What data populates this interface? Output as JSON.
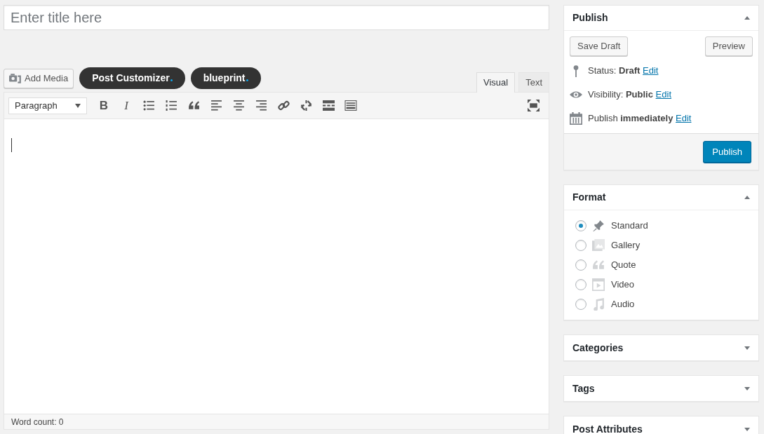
{
  "title_field": {
    "placeholder": "Enter title here"
  },
  "media_buttons": [
    {
      "kind": "media",
      "label": "Add Media"
    },
    {
      "kind": "plugin",
      "label": "Post Customizer"
    },
    {
      "kind": "plugin",
      "label": "blueprint"
    }
  ],
  "editor_tabs": [
    {
      "label": "Visual",
      "selected": true
    },
    {
      "label": "Text",
      "selected": false
    }
  ],
  "toolbar": {
    "format_select": "Paragraph",
    "tools": [
      {
        "kind": "bold",
        "glyph": "B"
      },
      {
        "kind": "italic",
        "glyph": "I"
      },
      {
        "kind": "bullet-list"
      },
      {
        "kind": "numbered-list"
      },
      {
        "kind": "quote"
      },
      {
        "kind": "align-left"
      },
      {
        "kind": "align-center"
      },
      {
        "kind": "align-right"
      },
      {
        "kind": "link"
      },
      {
        "kind": "unlink"
      },
      {
        "kind": "more"
      },
      {
        "kind": "keyboard"
      }
    ]
  },
  "word_count": "Word count: 0",
  "publish_box": {
    "title": "Publish",
    "expanded": true,
    "save_draft": "Save Draft",
    "preview": "Preview",
    "rows": [
      {
        "kind": "status",
        "label": "Status:",
        "value": "Draft",
        "link": "Edit"
      },
      {
        "kind": "visibility",
        "label": "Visibility:",
        "value": "Public",
        "link": "Edit"
      },
      {
        "kind": "schedule",
        "label": "Publish",
        "value": "immediately",
        "link": "Edit"
      }
    ],
    "publish_button": "Publish"
  },
  "format_box": {
    "title": "Format",
    "expanded": true,
    "options": [
      {
        "kind": "standard",
        "label": "Standard",
        "selected": true
      },
      {
        "kind": "gallery",
        "label": "Gallery",
        "selected": false
      },
      {
        "kind": "quote",
        "label": "Quote",
        "selected": false
      },
      {
        "kind": "video",
        "label": "Video",
        "selected": false
      },
      {
        "kind": "audio",
        "label": "Audio",
        "selected": false
      }
    ]
  },
  "other_boxes": [
    {
      "title": "Categories",
      "expanded": false
    },
    {
      "title": "Tags",
      "expanded": false
    },
    {
      "title": "Post Attributes",
      "expanded": false
    }
  ]
}
